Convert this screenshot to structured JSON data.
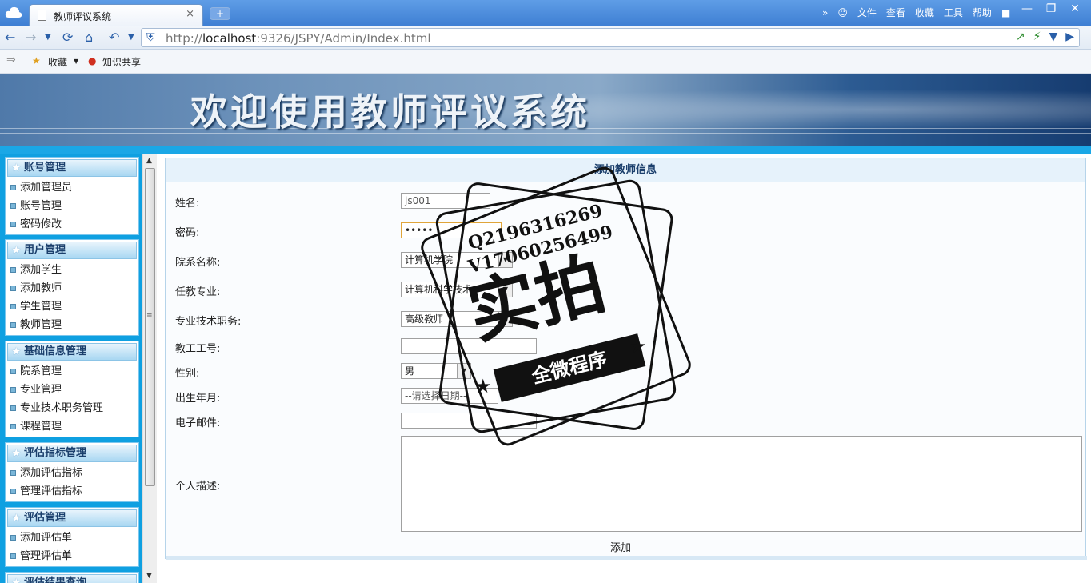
{
  "browser": {
    "tab_title": "教师评议系统",
    "tab_close": "×",
    "new_tab": "+",
    "url_prefix": "http://",
    "url_host": "localhost",
    "url_rest": ":9326/JSPY/Admin/Index.html",
    "menus": [
      "文件",
      "查看",
      "收藏",
      "工具",
      "帮助"
    ],
    "more": "»",
    "bookmarks": {
      "favorites": "收藏",
      "share": "知识共享"
    }
  },
  "banner": {
    "heading": "欢迎使用教师评议系统"
  },
  "sidebar": {
    "groups": [
      {
        "title": "账号管理",
        "items": [
          "添加管理员",
          "账号管理",
          "密码修改"
        ]
      },
      {
        "title": "用户管理",
        "items": [
          "添加学生",
          "添加教师",
          "学生管理",
          "教师管理"
        ]
      },
      {
        "title": "基础信息管理",
        "items": [
          "院系管理",
          "专业管理",
          "专业技术职务管理",
          "课程管理"
        ]
      },
      {
        "title": "评估指标管理",
        "items": [
          "添加评估指标",
          "管理评估指标"
        ]
      },
      {
        "title": "评估管理",
        "items": [
          "添加评估单",
          "管理评估单"
        ]
      },
      {
        "title": "评估结果查询",
        "items": []
      }
    ]
  },
  "form": {
    "title": "添加教师信息",
    "name_label": "姓名:",
    "name_value": "js001",
    "password_label": "密码:",
    "password_value": "•••••",
    "department_label": "院系名称:",
    "department_value": "计算机学院",
    "major_label": "任教专业:",
    "major_value": "计算机科学技术",
    "title_label": "专业技术职务:",
    "title_value": "高级教师",
    "staffno_label": "教工工号:",
    "staffno_value": "",
    "gender_label": "性别:",
    "gender_value": "男",
    "birth_label": "出生年月:",
    "birth_placeholder": "--请选择日期--",
    "email_label": "电子邮件:",
    "email_value": "",
    "desc_label": "个人描述:",
    "desc_value": "",
    "submit_label": "添加"
  },
  "watermark": {
    "line1": "Q2196316269",
    "line2": "V17060256499",
    "big": "实拍",
    "ribbon": "全微程序"
  }
}
